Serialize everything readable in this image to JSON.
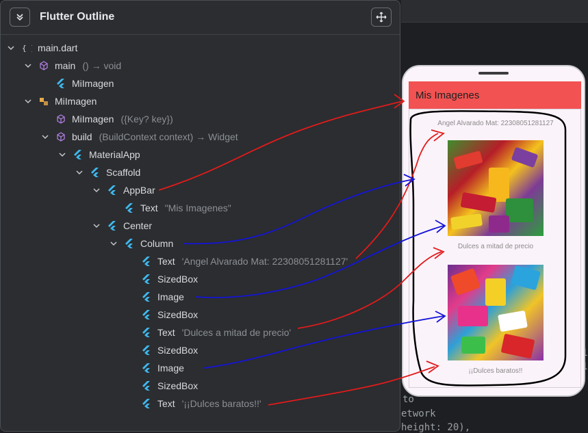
{
  "panel": {
    "title": "Flutter Outline"
  },
  "tree": [
    {
      "label": "main.dart",
      "detail": "",
      "icon": "braces",
      "chevron": true
    },
    {
      "label": "main",
      "detail": "() → void",
      "icon": "cube",
      "chevron": true
    },
    {
      "label": "MiImagen",
      "detail": "",
      "icon": "flutter",
      "chevron": false
    },
    {
      "label": "MiImagen",
      "detail": "",
      "icon": "class",
      "chevron": true
    },
    {
      "label": "MiImagen",
      "detail": "({Key? key})",
      "icon": "cube",
      "chevron": false
    },
    {
      "label": "build",
      "detail": "(BuildContext context) → Widget",
      "icon": "cube",
      "chevron": true
    },
    {
      "label": "MaterialApp",
      "detail": "",
      "icon": "flutter",
      "chevron": true
    },
    {
      "label": "Scaffold",
      "detail": "",
      "icon": "flutter",
      "chevron": true
    },
    {
      "label": "AppBar",
      "detail": "",
      "icon": "flutter",
      "chevron": true
    },
    {
      "label": "Text",
      "detail": "\"Mis Imagenes\"",
      "icon": "flutter",
      "chevron": false
    },
    {
      "label": "Center",
      "detail": "",
      "icon": "flutter",
      "chevron": true
    },
    {
      "label": "Column",
      "detail": "",
      "icon": "flutter",
      "chevron": true
    },
    {
      "label": "Text",
      "detail": "'Angel Alvarado Mat: 22308051281127'",
      "icon": "flutter",
      "chevron": false
    },
    {
      "label": "SizedBox",
      "detail": "",
      "icon": "flutter",
      "chevron": false
    },
    {
      "label": "Image",
      "detail": "",
      "icon": "flutter",
      "chevron": false
    },
    {
      "label": "SizedBox",
      "detail": "",
      "icon": "flutter",
      "chevron": false
    },
    {
      "label": "Text",
      "detail": "'Dulces a mitad de precio'",
      "icon": "flutter",
      "chevron": false
    },
    {
      "label": "SizedBox",
      "detail": "",
      "icon": "flutter",
      "chevron": false
    },
    {
      "label": "Image",
      "detail": "",
      "icon": "flutter",
      "chevron": false
    },
    {
      "label": "SizedBox",
      "detail": "",
      "icon": "flutter",
      "chevron": false
    },
    {
      "label": "Text",
      "detail": "'¡¡Dulces baratos!!'",
      "icon": "flutter",
      "chevron": false
    }
  ],
  "phone": {
    "appbar_title": "Mis Imagenes",
    "text1": "Angel Alvarado Mat: 22308051281127",
    "text2": "Dulces a mitad de precio",
    "text3": "¡¡Dulces baratos!!"
  },
  "editor": {
    "lines": [
      "to",
      "etwork",
      "height: 20),",
      "1",
      "1"
    ]
  },
  "colors": {
    "flutter_icon": "#3fb9f0",
    "cube_icon": "#b07ee0",
    "class_icon": "#e6a94a",
    "appbar": "#f25252",
    "annotation_red": "#e11b1b",
    "annotation_blue": "#1414d8"
  }
}
